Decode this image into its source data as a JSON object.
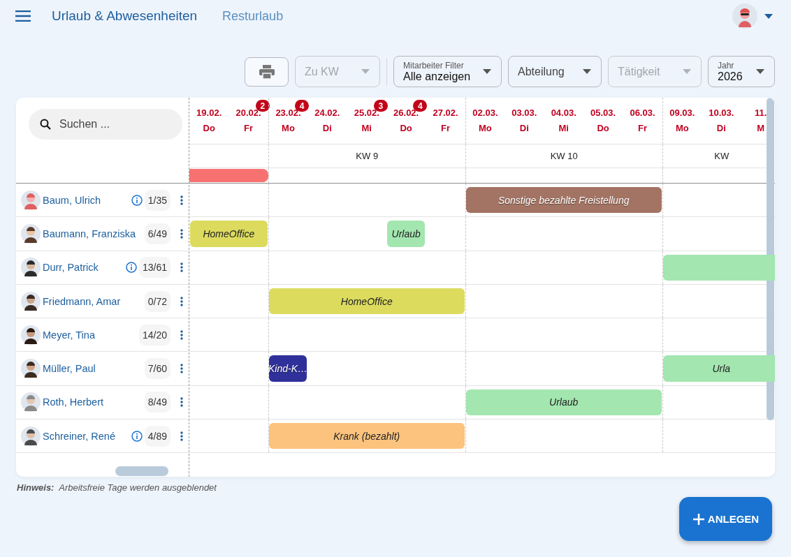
{
  "header": {
    "tabs": [
      {
        "label": "Urlaub & Abwesenheiten",
        "selected": true
      },
      {
        "label": "Resturlaub",
        "selected": false
      }
    ]
  },
  "toolbar": {
    "selects": [
      {
        "label": "Zu KW",
        "disabled": true
      },
      {
        "floating_label": "Mitarbeiter Filter",
        "value": "Alle anzeigen",
        "disabled": false
      },
      {
        "label": "Abteilung",
        "disabled": false
      },
      {
        "label": "Tätigkeit",
        "disabled": true
      },
      {
        "floating_label": "Jahr",
        "value": "2026",
        "disabled": false
      }
    ]
  },
  "search": {
    "placeholder": "Suchen ..."
  },
  "weeks": [
    {
      "days": [
        {
          "date": "19.02.",
          "weekday": "Do"
        },
        {
          "date": "20.02.",
          "weekday": "Fr",
          "badge": "2"
        }
      ],
      "summary": {
        "color": "#f87171"
      }
    },
    {
      "label": "KW 9",
      "days": [
        {
          "date": "23.02.",
          "weekday": "Mo",
          "badge": "4"
        },
        {
          "date": "24.02.",
          "weekday": "Di"
        },
        {
          "date": "25.02.",
          "weekday": "Mi",
          "badge": "3"
        },
        {
          "date": "26.02.",
          "weekday": "Do",
          "badge": "4"
        },
        {
          "date": "27.02.",
          "weekday": "Fr"
        }
      ]
    },
    {
      "label": "KW 10",
      "days": [
        {
          "date": "02.03.",
          "weekday": "Mo"
        },
        {
          "date": "03.03.",
          "weekday": "Di"
        },
        {
          "date": "04.03.",
          "weekday": "Mi"
        },
        {
          "date": "05.03.",
          "weekday": "Do"
        },
        {
          "date": "06.03.",
          "weekday": "Fr"
        }
      ]
    },
    {
      "label": "KW",
      "days": [
        {
          "date": "09.03.",
          "weekday": "Mo"
        },
        {
          "date": "10.03.",
          "weekday": "Di"
        },
        {
          "date": "11.",
          "weekday": "M"
        }
      ]
    }
  ],
  "employees": [
    {
      "name": "Baum, Ulrich",
      "info": true,
      "count": "1/35",
      "timeline": [
        {
          "kind": "free"
        },
        {
          "kind": "free"
        },
        {
          "kind": "free"
        },
        {
          "kind": "free"
        },
        {
          "kind": "free"
        },
        {
          "kind": "free"
        },
        {
          "kind": "free"
        },
        {
          "kind": "absence",
          "label": "Sonstige bezahlte Freistellung",
          "color": "#a37464"
        },
        {
          "kind": "continued"
        },
        {
          "kind": "continued"
        },
        {
          "kind": "continued"
        },
        {
          "kind": "continued"
        },
        {
          "kind": "free"
        },
        {
          "kind": "free"
        },
        {
          "kind": "free"
        }
      ]
    },
    {
      "name": "Baumann, Franziska",
      "info": false,
      "count": "6/49",
      "timeline": [
        {
          "kind": "absence",
          "label": "HomeOffice",
          "color": "#dcdb5e"
        },
        {
          "kind": "continued"
        },
        {
          "kind": "free"
        },
        {
          "kind": "free"
        },
        {
          "kind": "free"
        },
        {
          "kind": "absence",
          "label": "Urlaub",
          "color": "#a3e6b0"
        },
        {
          "kind": "free"
        },
        {
          "kind": "free"
        },
        {
          "kind": "free"
        },
        {
          "kind": "free"
        },
        {
          "kind": "free"
        },
        {
          "kind": "free"
        },
        {
          "kind": "free"
        },
        {
          "kind": "free"
        },
        {
          "kind": "free"
        }
      ]
    },
    {
      "name": "Durr, Patrick",
      "info": true,
      "count": "13/61",
      "timeline": [
        {
          "kind": "free"
        },
        {
          "kind": "free"
        },
        {
          "kind": "free"
        },
        {
          "kind": "free"
        },
        {
          "kind": "free"
        },
        {
          "kind": "free"
        },
        {
          "kind": "free"
        },
        {
          "kind": "free"
        },
        {
          "kind": "free"
        },
        {
          "kind": "free"
        },
        {
          "kind": "free"
        },
        {
          "kind": "free"
        },
        {
          "kind": "absence",
          "color": "#a3e6b0"
        },
        {
          "kind": "continued"
        },
        {
          "kind": "continued"
        }
      ]
    },
    {
      "name": "Friedmann, Amar",
      "info": false,
      "count": "0/72",
      "timeline": [
        {
          "kind": "free"
        },
        {
          "kind": "free"
        },
        {
          "kind": "absence",
          "label": "HomeOffice",
          "color": "#dcdb5e"
        },
        {
          "kind": "continued"
        },
        {
          "kind": "continued"
        },
        {
          "kind": "continued"
        },
        {
          "kind": "continued"
        },
        {
          "kind": "free"
        },
        {
          "kind": "free"
        },
        {
          "kind": "free"
        },
        {
          "kind": "free"
        },
        {
          "kind": "free"
        },
        {
          "kind": "free"
        },
        {
          "kind": "free"
        },
        {
          "kind": "free"
        }
      ]
    },
    {
      "name": "Meyer, Tina",
      "info": false,
      "count": "14/20",
      "timeline": [
        {
          "kind": "free"
        },
        {
          "kind": "free"
        },
        {
          "kind": "free"
        },
        {
          "kind": "free"
        },
        {
          "kind": "free"
        },
        {
          "kind": "free"
        },
        {
          "kind": "free"
        },
        {
          "kind": "free"
        },
        {
          "kind": "free"
        },
        {
          "kind": "free"
        },
        {
          "kind": "free"
        },
        {
          "kind": "free"
        },
        {
          "kind": "free"
        },
        {
          "kind": "free"
        },
        {
          "kind": "free"
        }
      ]
    },
    {
      "name": "Müller, Paul",
      "info": false,
      "count": "7/60",
      "timeline": [
        {
          "kind": "free"
        },
        {
          "kind": "free"
        },
        {
          "kind": "absence",
          "label": "Kind-K…",
          "color": "#30309a"
        },
        {
          "kind": "free"
        },
        {
          "kind": "free"
        },
        {
          "kind": "free"
        },
        {
          "kind": "free"
        },
        {
          "kind": "free"
        },
        {
          "kind": "free"
        },
        {
          "kind": "free"
        },
        {
          "kind": "free"
        },
        {
          "kind": "free"
        },
        {
          "kind": "absence",
          "label": "Urla",
          "color": "#a3e6b0"
        },
        {
          "kind": "continued"
        },
        {
          "kind": "continued"
        }
      ]
    },
    {
      "name": "Roth, Herbert",
      "info": false,
      "count": "8/49",
      "timeline": [
        {
          "kind": "free"
        },
        {
          "kind": "free"
        },
        {
          "kind": "free"
        },
        {
          "kind": "free"
        },
        {
          "kind": "free"
        },
        {
          "kind": "free"
        },
        {
          "kind": "free"
        },
        {
          "kind": "absence",
          "label": "Urlaub",
          "color": "#a3e6b0"
        },
        {
          "kind": "continued"
        },
        {
          "kind": "continued"
        },
        {
          "kind": "continued"
        },
        {
          "kind": "continued"
        },
        {
          "kind": "free"
        },
        {
          "kind": "free"
        },
        {
          "kind": "free"
        }
      ]
    },
    {
      "name": "Schreiner, René",
      "info": true,
      "count": "4/89",
      "timeline": [
        {
          "kind": "free"
        },
        {
          "kind": "free"
        },
        {
          "kind": "absence",
          "label": "Krank (bezahlt)",
          "color": "#fcc37e"
        },
        {
          "kind": "continued"
        },
        {
          "kind": "continued"
        },
        {
          "kind": "continued"
        },
        {
          "kind": "continued"
        },
        {
          "kind": "free"
        },
        {
          "kind": "free"
        },
        {
          "kind": "free"
        },
        {
          "kind": "free"
        },
        {
          "kind": "free"
        },
        {
          "kind": "free"
        },
        {
          "kind": "free"
        },
        {
          "kind": "free"
        }
      ]
    }
  ],
  "hint": {
    "label": "Hinweis:",
    "text": "Arbeitsfreie Tage werden ausgeblendet"
  },
  "fab": {
    "label": "ANLEGEN"
  }
}
